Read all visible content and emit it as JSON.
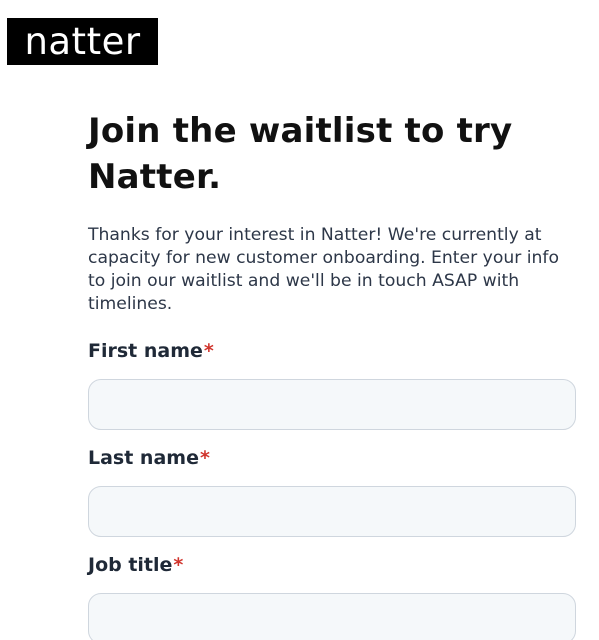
{
  "header": {
    "logo_text": "natter"
  },
  "main": {
    "title": "Join the waitlist to try Natter.",
    "intro": "Thanks for your interest in Natter! We're currently at capacity for new customer onboarding. Enter your info to join our waitlist and we'll be in touch ASAP with timelines."
  },
  "form": {
    "required_marker": "*",
    "fields": [
      {
        "label": "First name",
        "value": "",
        "placeholder": ""
      },
      {
        "label": "Last name",
        "value": "",
        "placeholder": ""
      },
      {
        "label": "Job title",
        "value": "",
        "placeholder": ""
      }
    ]
  },
  "colors": {
    "logo_bg": "#000000",
    "required": "#d0342c",
    "input_bg": "#f5f8fa",
    "input_border": "#cfd6de"
  }
}
